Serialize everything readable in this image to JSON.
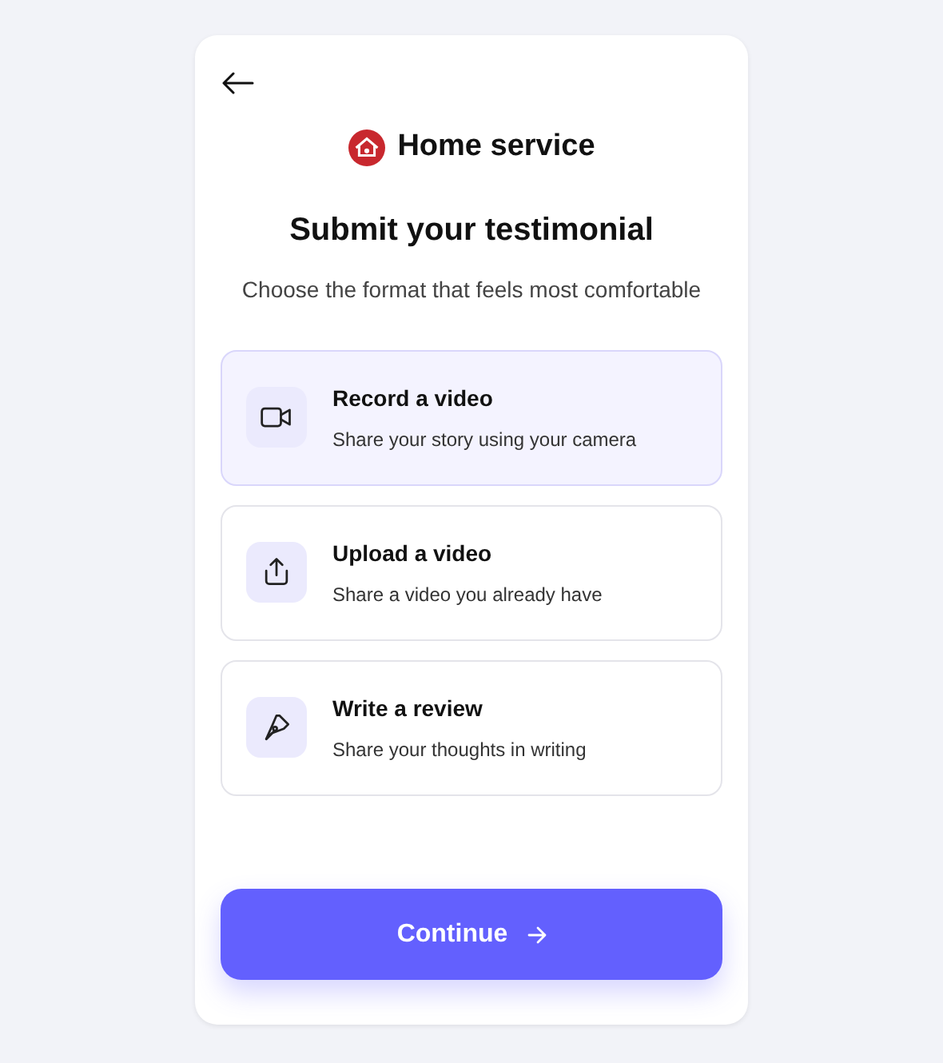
{
  "brand": {
    "name": "Home service"
  },
  "title": "Submit your testimonial",
  "subtitle": "Choose the format that feels most comfortable",
  "options": [
    {
      "kind": "camera",
      "title": "Record a video",
      "description": "Share your story using your camera",
      "selected": true
    },
    {
      "kind": "upload",
      "title": "Upload a video",
      "description": "Share a video you already have",
      "selected": false
    },
    {
      "kind": "pen",
      "title": "Write a review",
      "description": "Share your thoughts in writing",
      "selected": false
    }
  ],
  "button": {
    "label": "Continue"
  }
}
